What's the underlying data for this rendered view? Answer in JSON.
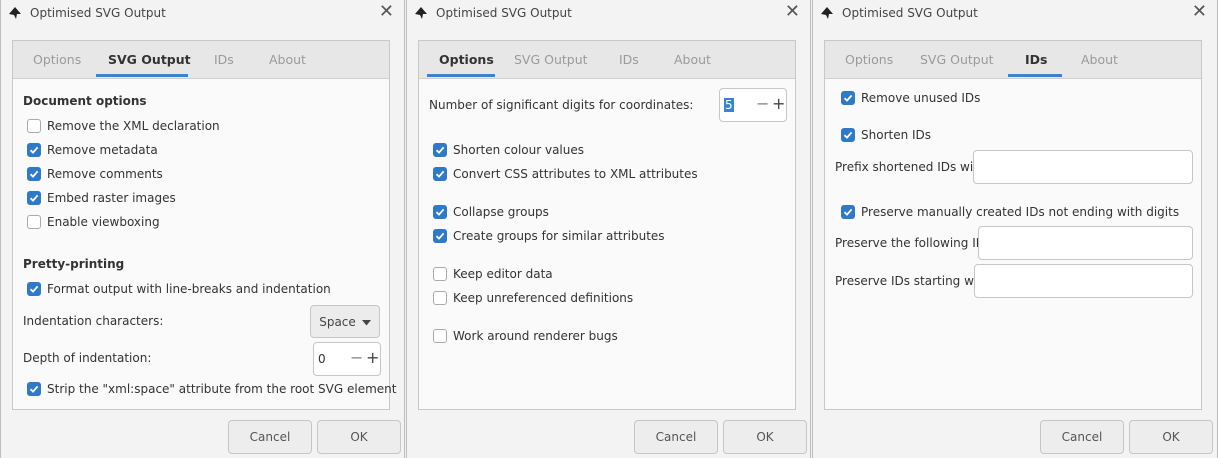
{
  "window_title": "Optimised SVG Output",
  "tabs": [
    "Options",
    "SVG Output",
    "IDs",
    "About"
  ],
  "buttons": {
    "cancel": "Cancel",
    "ok": "OK"
  },
  "panel1": {
    "document_options_header": "Document options",
    "doc_checks": [
      {
        "label": "Remove the XML declaration",
        "checked": false
      },
      {
        "label": "Remove metadata",
        "checked": true
      },
      {
        "label": "Remove comments",
        "checked": true
      },
      {
        "label": "Embed raster images",
        "checked": true
      },
      {
        "label": "Enable viewboxing",
        "checked": false
      }
    ],
    "pretty_printing_header": "Pretty-printing",
    "format_output": {
      "label": "Format output with line-breaks and indentation",
      "checked": true
    },
    "indentation_label": "Indentation characters:",
    "indentation_value": "Space",
    "depth_label": "Depth of indentation:",
    "depth_value": "0",
    "strip_xml_space": {
      "label": "Strip the \"xml:space\" attribute from the root SVG element",
      "checked": true
    }
  },
  "panel2": {
    "digits_label": "Number of significant digits for coordinates:",
    "digits_value": "5",
    "checks": [
      {
        "label": "Shorten colour values",
        "checked": true
      },
      {
        "label": "Convert CSS attributes to XML attributes",
        "checked": true
      },
      {
        "label": "Collapse groups",
        "checked": true
      },
      {
        "label": "Create groups for similar attributes",
        "checked": true
      },
      {
        "label": "Keep editor data",
        "checked": false
      },
      {
        "label": "Keep unreferenced definitions",
        "checked": false
      },
      {
        "label": "Work around renderer bugs",
        "checked": false
      }
    ]
  },
  "panel3": {
    "remove_unused": {
      "label": "Remove unused IDs",
      "checked": true
    },
    "shorten": {
      "label": "Shorten IDs",
      "checked": true
    },
    "prefix_label": "Prefix shortened IDs with:",
    "preserve_manual": {
      "label": "Preserve manually created IDs not ending with digits",
      "checked": true
    },
    "preserve_following_label": "Preserve the following IDs:",
    "preserve_starting_label": "Preserve IDs starting with:"
  }
}
